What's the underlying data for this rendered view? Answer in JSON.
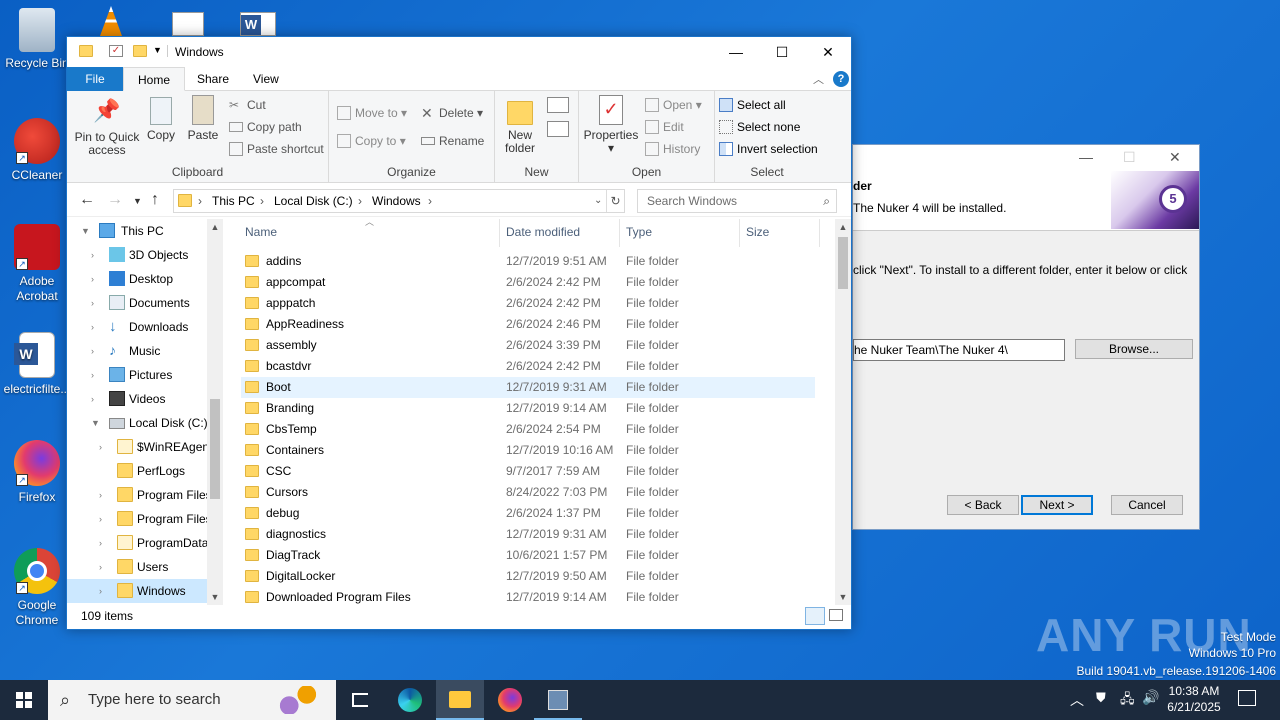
{
  "desktop": {
    "icons": [
      {
        "label": "Recycle Bin",
        "icon": "recycle-bin-icon"
      },
      {
        "label": "CCleaner",
        "icon": "ccleaner-icon"
      },
      {
        "label": "Adobe Acrobat",
        "icon": "adobe-acrobat-icon"
      },
      {
        "label": "electricfilte...",
        "icon": "word-document-icon"
      },
      {
        "label": "Firefox",
        "icon": "firefox-icon"
      },
      {
        "label": "Google Chrome",
        "icon": "chrome-icon"
      }
    ]
  },
  "installer": {
    "heading": "der",
    "subheading": "The Nuker 4 will be installed.",
    "body": "click \"Next\". To install to a different folder, enter it below or click",
    "path": "he Nuker Team\\The Nuker 4\\",
    "browse": "Browse...",
    "back": "< Back",
    "next": "Next >",
    "cancel": "Cancel"
  },
  "explorer": {
    "title": "Windows",
    "tabs": {
      "file": "File",
      "home": "Home",
      "share": "Share",
      "view": "View"
    },
    "ribbon": {
      "pin": "Pin to Quick access",
      "copy": "Copy",
      "paste": "Paste",
      "cut": "Cut",
      "copy_path": "Copy path",
      "paste_shortcut": "Paste shortcut",
      "clipboard": "Clipboard",
      "move_to": "Move to",
      "copy_to": "Copy to",
      "delete": "Delete",
      "rename": "Rename",
      "organize": "Organize",
      "new_folder": "New folder",
      "new": "New",
      "properties": "Properties",
      "open_btn": "Open",
      "edit": "Edit",
      "history": "History",
      "open_group": "Open",
      "select_all": "Select all",
      "select_none": "Select none",
      "invert_selection": "Invert selection",
      "select": "Select"
    },
    "address": {
      "crumbs": [
        "This PC",
        "Local Disk (C:)",
        "Windows"
      ]
    },
    "search_placeholder": "Search Windows",
    "nav": [
      {
        "label": "This PC"
      },
      {
        "label": "3D Objects"
      },
      {
        "label": "Desktop"
      },
      {
        "label": "Documents"
      },
      {
        "label": "Downloads"
      },
      {
        "label": "Music"
      },
      {
        "label": "Pictures"
      },
      {
        "label": "Videos"
      },
      {
        "label": "Local Disk (C:)"
      },
      {
        "label": "$WinREAgent"
      },
      {
        "label": "PerfLogs"
      },
      {
        "label": "Program Files"
      },
      {
        "label": "Program Files"
      },
      {
        "label": "ProgramData"
      },
      {
        "label": "Users"
      },
      {
        "label": "Windows"
      }
    ],
    "columns": {
      "name": "Name",
      "date": "Date modified",
      "type": "Type",
      "size": "Size"
    },
    "files": [
      {
        "name": "addins",
        "date": "12/7/2019 9:51 AM",
        "type": "File folder"
      },
      {
        "name": "appcompat",
        "date": "2/6/2024 2:42 PM",
        "type": "File folder"
      },
      {
        "name": "apppatch",
        "date": "2/6/2024 2:42 PM",
        "type": "File folder"
      },
      {
        "name": "AppReadiness",
        "date": "2/6/2024 2:46 PM",
        "type": "File folder"
      },
      {
        "name": "assembly",
        "date": "2/6/2024 3:39 PM",
        "type": "File folder"
      },
      {
        "name": "bcastdvr",
        "date": "2/6/2024 2:42 PM",
        "type": "File folder"
      },
      {
        "name": "Boot",
        "date": "12/7/2019 9:31 AM",
        "type": "File folder"
      },
      {
        "name": "Branding",
        "date": "12/7/2019 9:14 AM",
        "type": "File folder"
      },
      {
        "name": "CbsTemp",
        "date": "2/6/2024 2:54 PM",
        "type": "File folder"
      },
      {
        "name": "Containers",
        "date": "12/7/2019 10:16 AM",
        "type": "File folder"
      },
      {
        "name": "CSC",
        "date": "9/7/2017 7:59 AM",
        "type": "File folder"
      },
      {
        "name": "Cursors",
        "date": "8/24/2022 7:03 PM",
        "type": "File folder"
      },
      {
        "name": "debug",
        "date": "2/6/2024 1:37 PM",
        "type": "File folder"
      },
      {
        "name": "diagnostics",
        "date": "12/7/2019 9:31 AM",
        "type": "File folder"
      },
      {
        "name": "DiagTrack",
        "date": "10/6/2021 1:57 PM",
        "type": "File folder"
      },
      {
        "name": "DigitalLocker",
        "date": "12/7/2019 9:50 AM",
        "type": "File folder"
      },
      {
        "name": "Downloaded Program Files",
        "date": "12/7/2019 9:14 AM",
        "type": "File folder"
      }
    ],
    "status": "109 items"
  },
  "taskbar": {
    "search_placeholder": "Type here to search",
    "time": "10:38 AM",
    "date": "6/21/2025"
  },
  "watermark": {
    "brand": "ANY RUN",
    "line1": "Test Mode",
    "line2": "Windows 10 Pro",
    "line3": "Build 19041.vb_release.191206-1406"
  }
}
